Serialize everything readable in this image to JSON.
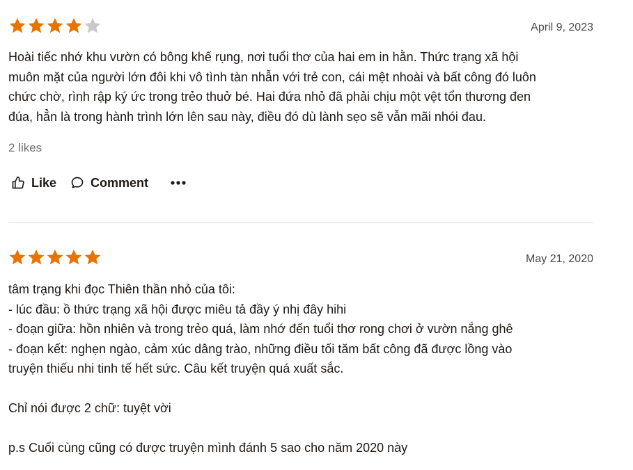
{
  "reviews": [
    {
      "rating": 4,
      "max_rating": 5,
      "date": "April 9, 2023",
      "text": "Hoài tiếc nhớ khu vườn có bông khế rụng, nơi tuổi thơ của hai em in hằn. Thức trạng xã hội\nmuôn mặt của người lớn đôi khi vô tình tàn nhẫn với trẻ con, cái mệt nhoài và bất công đó luôn\nchức chờ, rình rập ký ức trong trẻo thuở bé. Hai đứa nhỏ đã phải chịu một vệt tổn thương đen\nđúa, hẳn là trong hành trình lớn lên sau này, điều đó dù lành sẹo sẽ vẫn mãi nhói đau.",
      "likes": "2 likes",
      "actions": {
        "like_label": "Like",
        "comment_label": "Comment"
      }
    },
    {
      "rating": 5,
      "max_rating": 5,
      "date": "May 21, 2020",
      "text": "tâm trạng khi đọc Thiên thần nhỏ của tôi:\n- lúc đầu: ồ thức trạng xã hội được miêu tả đầy ý nhị đây hihi\n- đoạn giữa: hồn nhiên và trong trẻo quá, làm nhớ đến tuổi thơ rong chơi ở vườn nắng ghê\n- đoạn kết: nghẹn ngào, cảm xúc dâng trào, những điều tối tăm bất công đã được lồng vào\ntruyện thiếu nhi tinh tế hết sức. Câu kết truyện quá xuất sắc.\n\nChỉ nói được 2 chữ: tuyệt vời\n\np.s Cuối cùng cũng có được truyện mình đánh 5 sao cho năm 2020 này"
    }
  ],
  "colors": {
    "star_filled": "#e87400",
    "star_empty": "#c8c8c8",
    "text": "#1e1915",
    "muted": "#707070",
    "divider": "#d8d8d8"
  },
  "icons": {
    "star": "star-icon",
    "like": "thumbs-up-icon",
    "comment": "comment-bubble-icon",
    "more": "more-dots-icon"
  }
}
